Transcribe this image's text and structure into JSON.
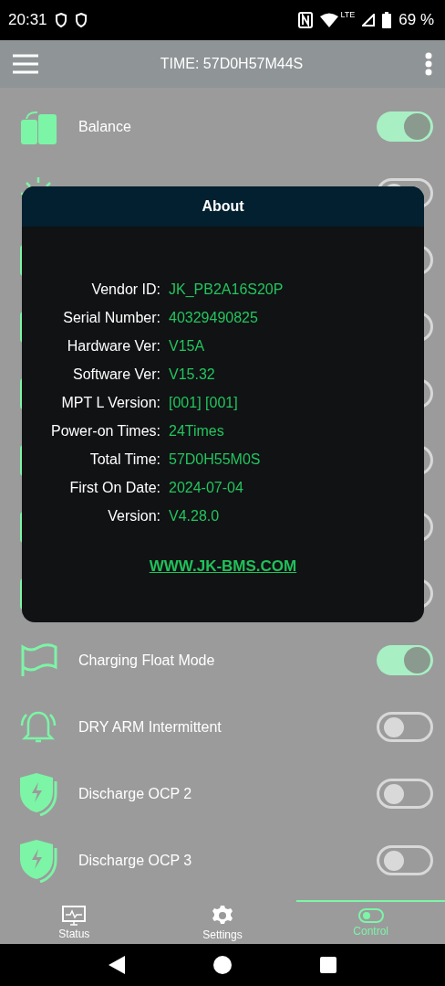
{
  "status_bar": {
    "time": "20:31",
    "network": "LTE",
    "battery": "69 %"
  },
  "app_bar": {
    "title": "TIME: 57D0H57M44S"
  },
  "rows": [
    {
      "label": "Balance",
      "on": true
    },
    {
      "on": false
    },
    {
      "on": false
    },
    {
      "on": false
    },
    {
      "on": false
    },
    {
      "on": false
    },
    {
      "on": false
    },
    {
      "on": false
    },
    {
      "label": "Charging Float Mode",
      "on": true
    },
    {
      "label": "DRY ARM Intermittent",
      "on": false
    },
    {
      "label": "Discharge OCP 2",
      "on": false
    },
    {
      "label": "Discharge OCP 3",
      "on": false
    }
  ],
  "dialog": {
    "title": "About",
    "fields": [
      {
        "label": "Vendor ID:",
        "value": "JK_PB2A16S20P"
      },
      {
        "label": "Serial Number:",
        "value": "40329490825"
      },
      {
        "label": "Hardware Ver:",
        "value": "V15A"
      },
      {
        "label": "Software Ver:",
        "value": "V15.32"
      },
      {
        "label": "MPT L Version:",
        "value": "[001] [001]"
      },
      {
        "label": "Power-on Times:",
        "value": "24Times"
      },
      {
        "label": "Total Time:",
        "value": "57D0H55M0S"
      },
      {
        "label": "First On Date:",
        "value": "2024-07-04"
      },
      {
        "label": "Version:",
        "value": "V4.28.0"
      }
    ],
    "link": "WWW.JK-BMS.COM"
  },
  "bottom_nav": [
    {
      "label": "Status",
      "selected": false
    },
    {
      "label": "Settings",
      "selected": false
    },
    {
      "label": "Control",
      "selected": true
    }
  ]
}
